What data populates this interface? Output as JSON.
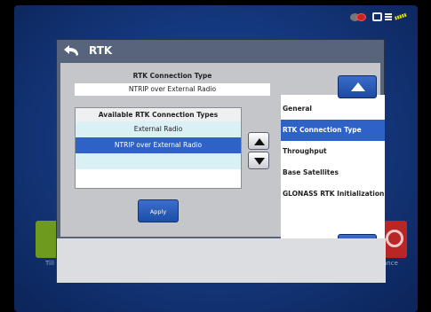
{
  "window": {
    "title": "RTK"
  },
  "connection": {
    "type_label": "RTK Connection Type",
    "type_value": "NTRIP over External Radio"
  },
  "available": {
    "header": "Available RTK Connection Types",
    "items": [
      "External Radio",
      "NTRIP over External Radio"
    ],
    "selected_index": 1
  },
  "apply_label": "Apply",
  "nav": {
    "items": [
      "General",
      "RTK Connection Type",
      "Throughput",
      "Base Satellites",
      "GLONASS RTK Initialization"
    ],
    "active_index": 1
  },
  "background_apps": {
    "left_label": "Till",
    "right_label": "ance"
  },
  "icons": {
    "back": "back-arrow-icon",
    "list_up": "arrow-up-icon",
    "list_down": "arrow-down-icon",
    "nav_up": "arrow-up-icon",
    "nav_down": "arrow-down-icon",
    "status": [
      "satellite-status-icon",
      "display-icon",
      "menu-icon",
      "signal-icon"
    ]
  },
  "colors": {
    "accent_blue": "#2f62c6",
    "background_blue": "#1d4fa6",
    "window_gray": "#58647c",
    "list_light": "#d9f0f4"
  }
}
